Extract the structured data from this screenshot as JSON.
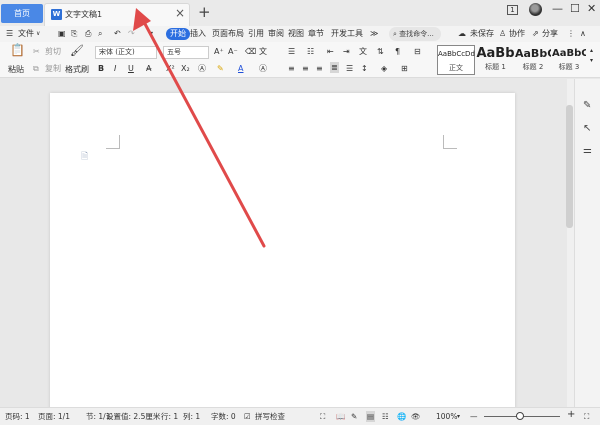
{
  "titlebar": {
    "home_label": "首页",
    "doc_tab": {
      "icon": "W",
      "title": "文字文稿1",
      "close": "×"
    },
    "new_tab": "+",
    "page_badge": "1",
    "window": {
      "minimize": "—",
      "maximize": "☐",
      "close": "✕"
    }
  },
  "menubar": {
    "file_label": "文件",
    "tabs": [
      "开始",
      "插入",
      "页面布局",
      "引用",
      "审阅",
      "视图",
      "章节",
      "开发工具",
      "≫"
    ],
    "active_tab": "开始",
    "search_label": "查找命令...",
    "unsaved_label": "未保存",
    "collab_label": "协作",
    "share_label": "分享"
  },
  "ribbon": {
    "paste": "粘贴",
    "cut": "剪切",
    "copy": "复制",
    "format_painter": "格式刷",
    "font_name": "宋体 (正文)",
    "font_size": "五号",
    "styles": [
      {
        "sample": "AaBbCcDd",
        "caption": "正文"
      },
      {
        "sample": "AaBb",
        "caption": "标题 1"
      },
      {
        "sample": "AaBbC",
        "caption": "标题 2"
      },
      {
        "sample": "AaBbC",
        "caption": "标题 3"
      }
    ]
  },
  "statusbar": {
    "page_num": "页码: 1",
    "pages": "页面: 1/1",
    "section": "节: 1/1",
    "setting": "设置值: 2.5厘米",
    "row": "行: 1",
    "col": "列: 1",
    "word_count": "字数: 0",
    "spell_check": "拼写检查",
    "zoom": "100%",
    "zoom_minus": "—",
    "zoom_plus": "+"
  },
  "colors": {
    "accent": "#2c6ee0",
    "home_tab": "#4a88e6",
    "arrow": "#e04a4a"
  }
}
